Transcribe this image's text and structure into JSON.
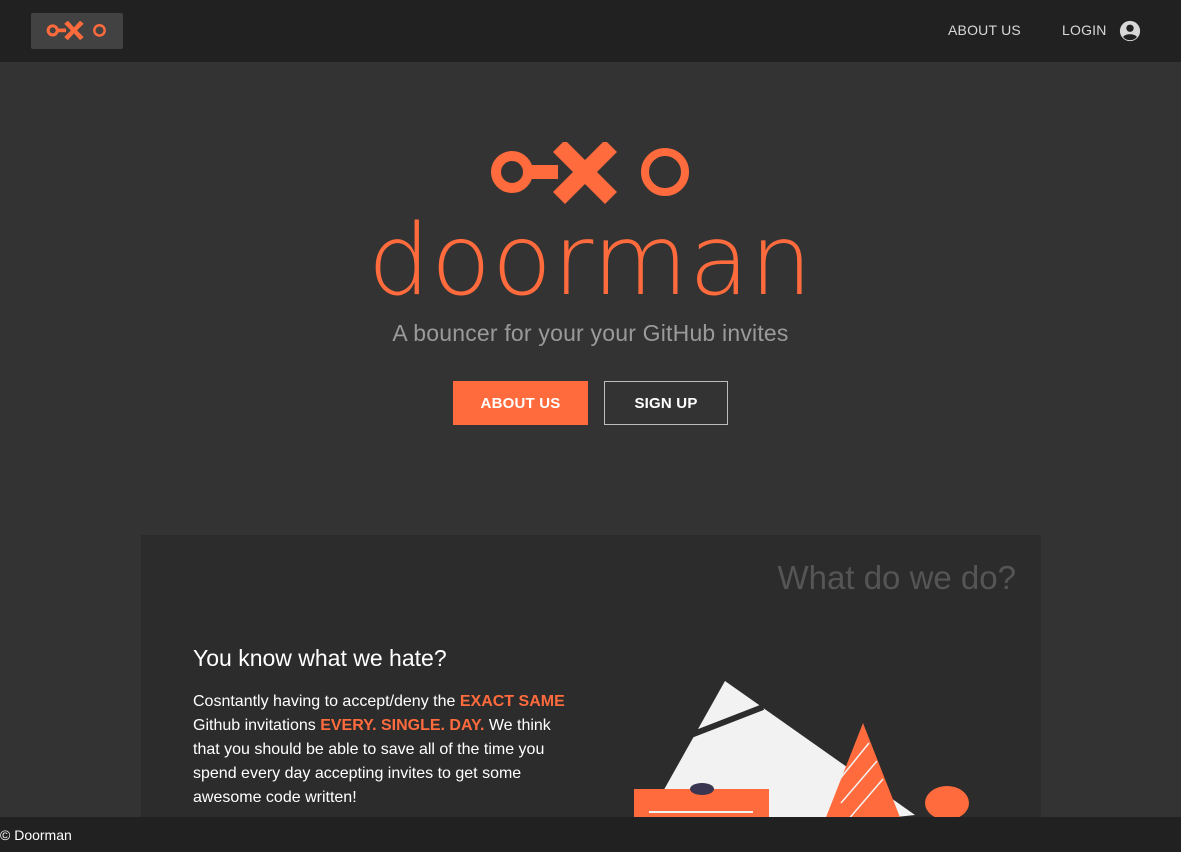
{
  "colors": {
    "accent": "#ff6b3d",
    "nav_bg": "#212121",
    "page_bg": "#333333",
    "card_bg": "#2c2c2c"
  },
  "nav": {
    "logo_icon": "doorman-logo-icon",
    "links": [
      {
        "label": "ABOUT US"
      },
      {
        "label": "LOGIN"
      }
    ],
    "account_icon": "account-circle-icon"
  },
  "hero": {
    "wordmark": "doorman",
    "tagline": "A bouncer for your your GitHub invites",
    "buttons": {
      "about": "ABOUT US",
      "signup": "SIGN UP"
    }
  },
  "card": {
    "title": "What do we do?",
    "heading": "You know what we hate?",
    "text_1": "Cosntantly having to accept/deny the ",
    "highlight_1": "EXACT SAME",
    "text_2": " Github invitations ",
    "highlight_2": "EVERY. SINGLE. DAY.",
    "text_3": " We think that you should be able to save all of the time you spend every day accepting invites to get some awesome code written!",
    "illustration_icon": "abstract-shapes-illustration"
  },
  "footer": {
    "copyright": "© Doorman"
  }
}
